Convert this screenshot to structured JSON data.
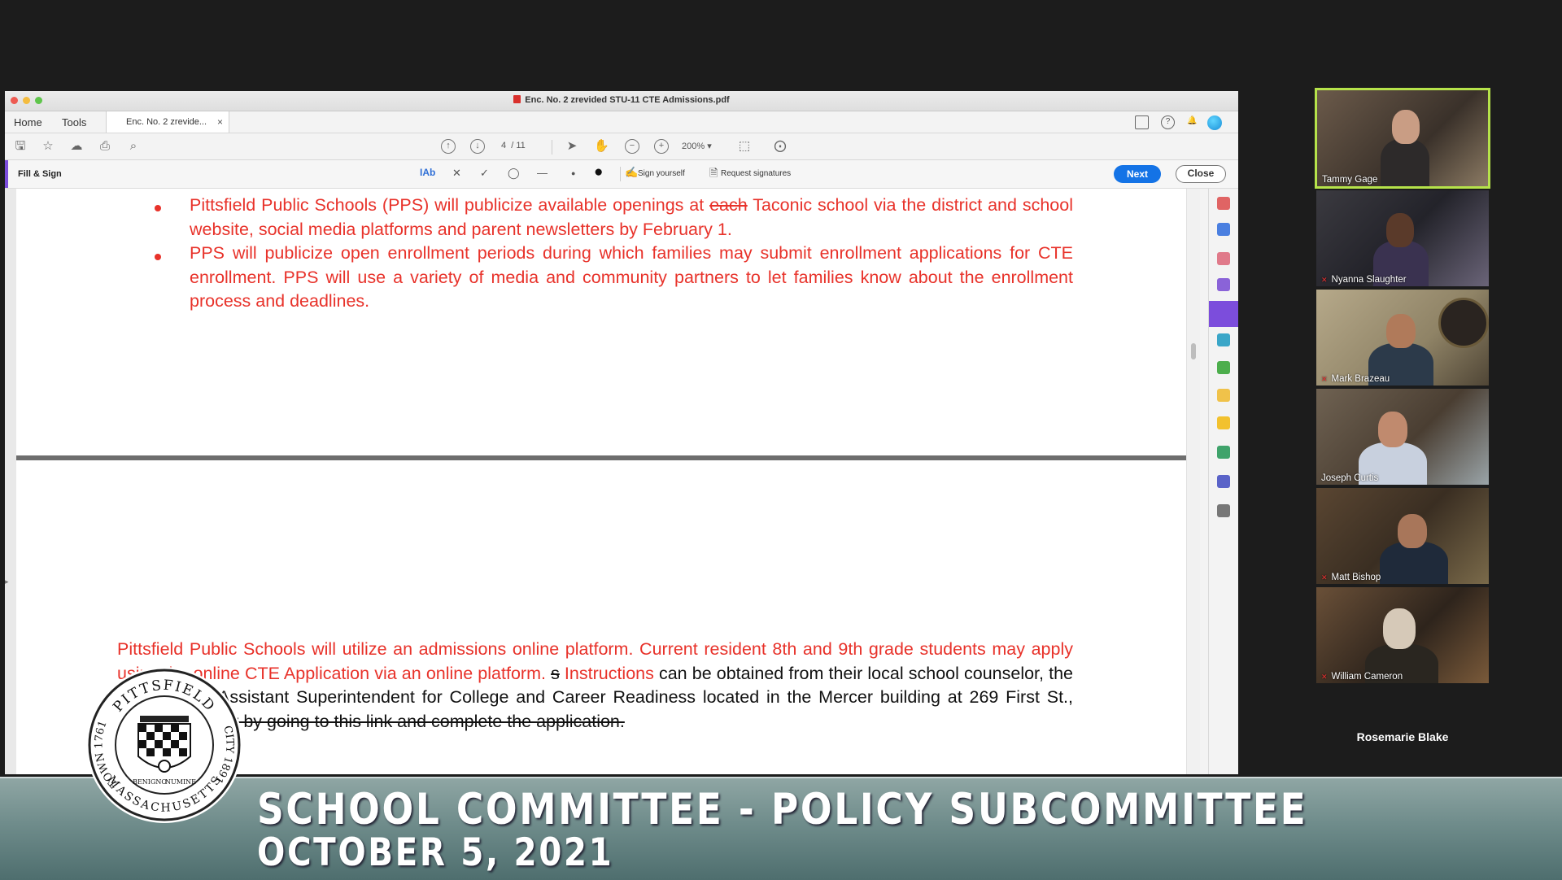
{
  "window": {
    "title": "Enc. No. 2 zrevided STU-11 CTE Admissions.pdf",
    "menu": [
      "Home",
      "Tools"
    ],
    "tab_label": "Enc. No. 2 zrevide...",
    "tab_close": "×"
  },
  "toolbar": {
    "page_current": "4",
    "page_total": "/ 11",
    "zoom": "200%"
  },
  "fill_sign": {
    "label": "Fill & Sign",
    "text_tool": "IAb",
    "sign_yourself": "Sign yourself",
    "request_signatures": "Request signatures",
    "next_label": "Next",
    "close_label": "Close"
  },
  "document": {
    "bullet1_a": "Pittsfield Public Schools (PPS) will publicize available openings at ",
    "bullet1_strike": "each",
    "bullet1_b": " Taconic school via the district and school  website, social media platforms and parent newsletters by February 1.",
    "bullet2": "PPS will publicize open enrollment periods during which families may submit enrollment applications for CTE enrollment. PPS will use a variety of media and community partners to let families know about the enrollment process and deadlines.",
    "para_red": "Pittsfield Public Schools will utilize an admissions online platform. Current resident 8th and 9th grade students may apply using the online CTE Application via an online platform. ",
    "para_strike_s": "s",
    "para_red2": " Instructions",
    "para_black": " can be obtained from their local school counselor, the office of the Assistant Superintendent  for College and Career Readiness located in the Mercer building at 269 First St., Pittsfield, MA ",
    "para_strike_end": "or by  going to this link and complete the application."
  },
  "participants": [
    {
      "name": "Tammy Gage",
      "active": true
    },
    {
      "name": "Nyanna Slaughter",
      "muted": true
    },
    {
      "name": "Mark Brazeau",
      "muted": true
    },
    {
      "name": "Joseph Curtis",
      "muted": false
    },
    {
      "name": "Matt Bishop",
      "muted": true
    },
    {
      "name": "William Cameron",
      "muted": true
    },
    {
      "name": "Rosemarie Blake",
      "video": false
    }
  ],
  "banner": {
    "title": "SCHOOL COMMITTEE - POLICY SUBCOMMITTEE",
    "date": "OCTOBER 5, 2021"
  },
  "seal": {
    "top": "PITTSFIELD",
    "left": "TOWN 1761",
    "right": "CITY 1891",
    "bottom": "MASSACHUSETTS",
    "motto_1": "BENIGNO",
    "motto_2": "NUMINE"
  },
  "colors": {
    "doc_red": "#e8322a",
    "accent_purple": "#7c4ddc",
    "button_blue": "#1473e6",
    "active_speaker": "#b6e34a"
  }
}
